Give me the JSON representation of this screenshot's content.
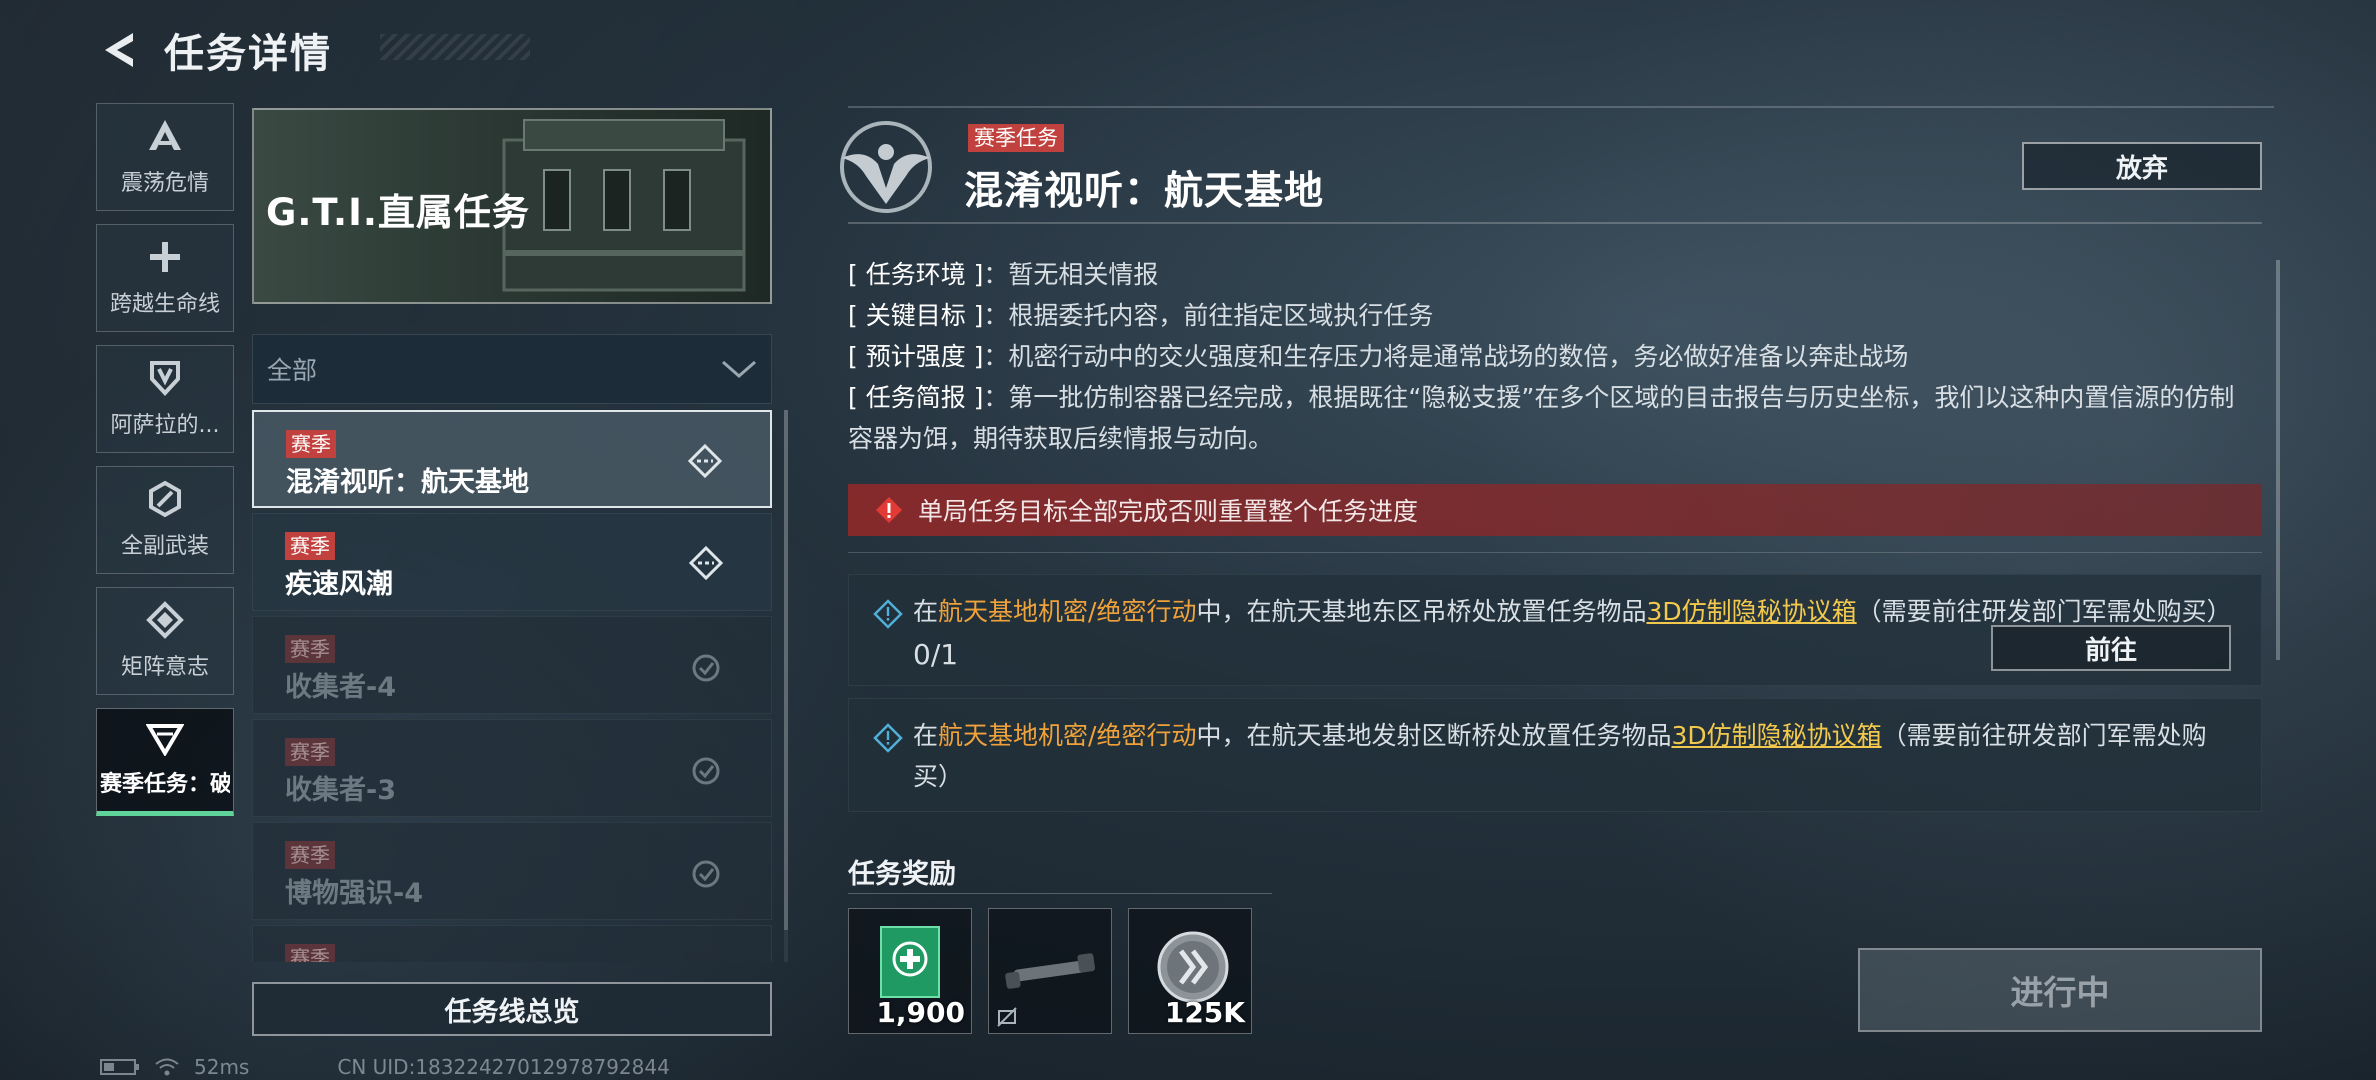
{
  "header": {
    "title": "任务详情"
  },
  "categories": [
    {
      "label": "震荡危情",
      "icon": "triangle-a-icon"
    },
    {
      "label": "跨越生命线",
      "icon": "plus-icon"
    },
    {
      "label": "阿萨拉的...",
      "icon": "shield-icon"
    },
    {
      "label": "全副武装",
      "icon": "hexagon-icon"
    },
    {
      "label": "矩阵意志",
      "icon": "diamond-icon"
    },
    {
      "label": "赛季任务：破",
      "icon": "down-triangle-icon",
      "active": true
    }
  ],
  "banner": {
    "title": "G.T.I.直属任务"
  },
  "filter": {
    "value": "全部"
  },
  "missions": [
    {
      "tag": "赛季",
      "name": "混淆视听：航天基地",
      "state": "active"
    },
    {
      "tag": "赛季",
      "name": "疾速风潮",
      "state": "active"
    },
    {
      "tag": "赛季",
      "name": "收集者-4",
      "state": "done"
    },
    {
      "tag": "赛季",
      "name": "收集者-3",
      "state": "done"
    },
    {
      "tag": "赛季",
      "name": "博物强识-4",
      "state": "done"
    },
    {
      "tag": "赛季",
      "name": "",
      "state": "done"
    }
  ],
  "overview_button": "任务线总览",
  "statusbar": {
    "ping": "52ms",
    "uid": "CN UID:18322427012978792844"
  },
  "detail": {
    "tag": "赛季任务",
    "title": "混淆视听：航天基地",
    "abandon_label": "放弃",
    "info": [
      {
        "key": "[ 任务环境 ]",
        "value": "暂无相关情报"
      },
      {
        "key": "[ 关键目标 ]",
        "value": "根据委托内容，前往指定区域执行任务"
      },
      {
        "key": "[ 预计强度 ]",
        "value": "机密行动中的交火强度和生存压力将是通常战场的数倍，务必做好准备以奔赴战场"
      },
      {
        "key": "[ 任务简报 ]",
        "value": "第一批仿制容器已经完成，根据既往“隐秘支援”在多个区域的目击报告与历史坐标，我们以这种内置信源的仿制容器为饵，期待获取后续情报与动向。"
      }
    ],
    "warning": "单局任务目标全部完成否则重置整个任务进度",
    "objectives": [
      {
        "pre": "在",
        "mode": "航天基地机密/绝密行动",
        "mid": "中，在航天基地东区吊桥处放置任务物品",
        "item": "3D仿制隐秘协议箱",
        "post": "（需要前往研发部门军需处购买）",
        "progress": "0/1",
        "goto_label": "前往"
      },
      {
        "pre": "在",
        "mode": "航天基地机密/绝密行动",
        "mid": "中，在航天基地发射区断桥处放置任务物品",
        "item": "3D仿制隐秘协议箱",
        "post": "（需要前往研发部门军需处购买）",
        "progress": "",
        "goto_label": ""
      }
    ]
  },
  "rewards": {
    "title": "任务奖励",
    "items": [
      {
        "qty": "1,900",
        "icon": "green-medkit-icon"
      },
      {
        "qty": "",
        "icon": "rifle-scope-icon"
      },
      {
        "qty": "125K",
        "icon": "silver-coin-icon"
      }
    ]
  },
  "status_button": "进行中",
  "colors": {
    "accent_green": "#5fd39a",
    "season_red": "#c0413d",
    "highlight_orange": "#f0a23a",
    "link_yellow": "#f2c94c"
  }
}
